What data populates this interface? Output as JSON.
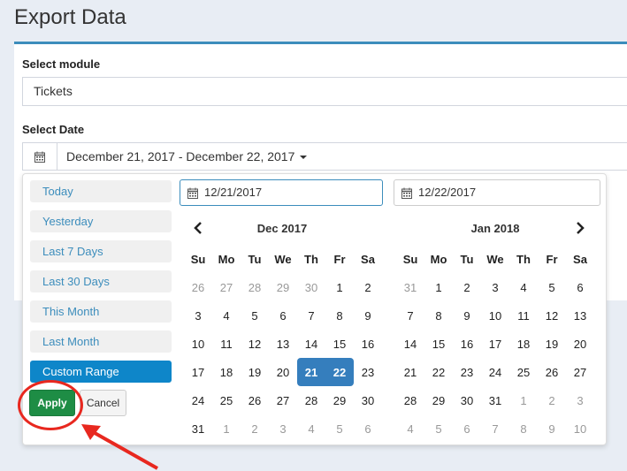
{
  "page": {
    "title": "Export Data"
  },
  "module": {
    "label": "Select module",
    "value": "Tickets"
  },
  "date": {
    "label": "Select Date",
    "value": "December 21, 2017 - December 22, 2017"
  },
  "ranges": [
    {
      "label": "Today",
      "active": false
    },
    {
      "label": "Yesterday",
      "active": false
    },
    {
      "label": "Last 7 Days",
      "active": false
    },
    {
      "label": "Last 30 Days",
      "active": false
    },
    {
      "label": "This Month",
      "active": false
    },
    {
      "label": "Last Month",
      "active": false
    },
    {
      "label": "Custom Range",
      "active": true
    }
  ],
  "buttons": {
    "apply": "Apply",
    "cancel": "Cancel"
  },
  "inputs": {
    "start": "12/21/2017",
    "end": "12/22/2017"
  },
  "weekdays": [
    "Su",
    "Mo",
    "Tu",
    "We",
    "Th",
    "Fr",
    "Sa"
  ],
  "calendars": [
    {
      "month": "Dec 2017",
      "days": [
        [
          {
            "d": "26",
            "off": true
          },
          {
            "d": "27",
            "off": true
          },
          {
            "d": "28",
            "off": true
          },
          {
            "d": "29",
            "off": true
          },
          {
            "d": "30",
            "off": true
          },
          {
            "d": "1"
          },
          {
            "d": "2"
          }
        ],
        [
          {
            "d": "3"
          },
          {
            "d": "4"
          },
          {
            "d": "5"
          },
          {
            "d": "6"
          },
          {
            "d": "7"
          },
          {
            "d": "8"
          },
          {
            "d": "9"
          }
        ],
        [
          {
            "d": "10"
          },
          {
            "d": "11"
          },
          {
            "d": "12"
          },
          {
            "d": "13"
          },
          {
            "d": "14"
          },
          {
            "d": "15"
          },
          {
            "d": "16"
          }
        ],
        [
          {
            "d": "17"
          },
          {
            "d": "18"
          },
          {
            "d": "19"
          },
          {
            "d": "20"
          },
          {
            "d": "21",
            "sel": "start"
          },
          {
            "d": "22",
            "sel": "end"
          },
          {
            "d": "23"
          }
        ],
        [
          {
            "d": "24"
          },
          {
            "d": "25"
          },
          {
            "d": "26"
          },
          {
            "d": "27"
          },
          {
            "d": "28"
          },
          {
            "d": "29"
          },
          {
            "d": "30"
          }
        ],
        [
          {
            "d": "31"
          },
          {
            "d": "1",
            "off": true
          },
          {
            "d": "2",
            "off": true
          },
          {
            "d": "3",
            "off": true
          },
          {
            "d": "4",
            "off": true
          },
          {
            "d": "5",
            "off": true
          },
          {
            "d": "6",
            "off": true
          }
        ]
      ]
    },
    {
      "month": "Jan 2018",
      "days": [
        [
          {
            "d": "31",
            "off": true
          },
          {
            "d": "1"
          },
          {
            "d": "2"
          },
          {
            "d": "3"
          },
          {
            "d": "4"
          },
          {
            "d": "5"
          },
          {
            "d": "6"
          }
        ],
        [
          {
            "d": "7"
          },
          {
            "d": "8"
          },
          {
            "d": "9"
          },
          {
            "d": "10"
          },
          {
            "d": "11"
          },
          {
            "d": "12"
          },
          {
            "d": "13"
          }
        ],
        [
          {
            "d": "14"
          },
          {
            "d": "15"
          },
          {
            "d": "16"
          },
          {
            "d": "17"
          },
          {
            "d": "18"
          },
          {
            "d": "19"
          },
          {
            "d": "20"
          }
        ],
        [
          {
            "d": "21"
          },
          {
            "d": "22"
          },
          {
            "d": "23"
          },
          {
            "d": "24"
          },
          {
            "d": "25"
          },
          {
            "d": "26"
          },
          {
            "d": "27"
          }
        ],
        [
          {
            "d": "28"
          },
          {
            "d": "29"
          },
          {
            "d": "30"
          },
          {
            "d": "31"
          },
          {
            "d": "1",
            "off": true
          },
          {
            "d": "2",
            "off": true
          },
          {
            "d": "3",
            "off": true
          }
        ],
        [
          {
            "d": "4",
            "off": true
          },
          {
            "d": "5",
            "off": true
          },
          {
            "d": "6",
            "off": true
          },
          {
            "d": "7",
            "off": true
          },
          {
            "d": "8",
            "off": true
          },
          {
            "d": "9",
            "off": true
          },
          {
            "d": "10",
            "off": true
          }
        ]
      ]
    }
  ],
  "colors": {
    "accent": "#3c8dbc",
    "active_range": "#0e86c9",
    "apply": "#1e8d45",
    "selected_day": "#357ebd",
    "annotation": "#e8281f"
  },
  "icons": {
    "calendar": "calendar-icon",
    "prev": "chevron-left-icon",
    "next": "chevron-right-icon"
  }
}
